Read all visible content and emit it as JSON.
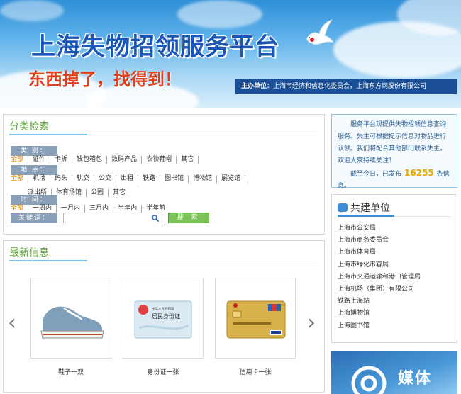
{
  "banner": {
    "title": "上海失物招领服务平台",
    "slogan": "东西掉了，找得到！",
    "sponsor_label": "主办单位：",
    "sponsor_text": "上海市经济和信息化委员会，上海东方网股份有限公司"
  },
  "search": {
    "title": "分类检索",
    "category": {
      "label": "类    别：",
      "options": [
        "全部",
        "证件",
        "卡折",
        "钱包箱包",
        "数码产品",
        "衣物鞋帽",
        "其它"
      ]
    },
    "location": {
      "label": "地    点：",
      "options": [
        "全部",
        "机场",
        "码头",
        "轨交",
        "公交",
        "出租",
        "铁路",
        "图书馆",
        "博物馆",
        "展览馆",
        "派出所",
        "体育场馆",
        "公园",
        "其它"
      ]
    },
    "time": {
      "label": "时    间：",
      "options": [
        "全部",
        "一周内",
        "一月内",
        "三月内",
        "半年内",
        "半年前"
      ]
    },
    "keyword": {
      "label": "关键词：",
      "value": "",
      "button_label": "搜 索"
    }
  },
  "latest": {
    "title": "最新信息",
    "prev_label": "‹",
    "next_label": "›",
    "items": [
      {
        "caption": "鞋子一双"
      },
      {
        "caption": "身份证一张"
      },
      {
        "caption": "信用卡一张"
      }
    ],
    "idcard_text": "居民身份证",
    "idcard_header": "中华人民共和国"
  },
  "notice": {
    "text1": "服务平台现提供失物招领信息查询服务。失主可根据提示信息对物品进行认领。我们将配合其他部门联系失主，欢迎大家持续关注！",
    "text2_prefix": "截至今日，已发布",
    "count": "16255",
    "text2_suffix": "条信息。"
  },
  "partners": {
    "title": "共建单位",
    "items": [
      "上海市公安局",
      "上海市商务委员会",
      "上海市体育局",
      "上海市绿化市容局",
      "上海市交通运输和港口管理局",
      "上海机场（集团）有限公司",
      "铁路上海站",
      "上海博物馆",
      "上海图书馆"
    ]
  },
  "media": {
    "label": "媒体"
  },
  "colors": {
    "accent_green": "#5da63a",
    "active_orange": "#e67e00",
    "banner_blue": "#1a4f96",
    "title_blue": "#1a55b8"
  }
}
